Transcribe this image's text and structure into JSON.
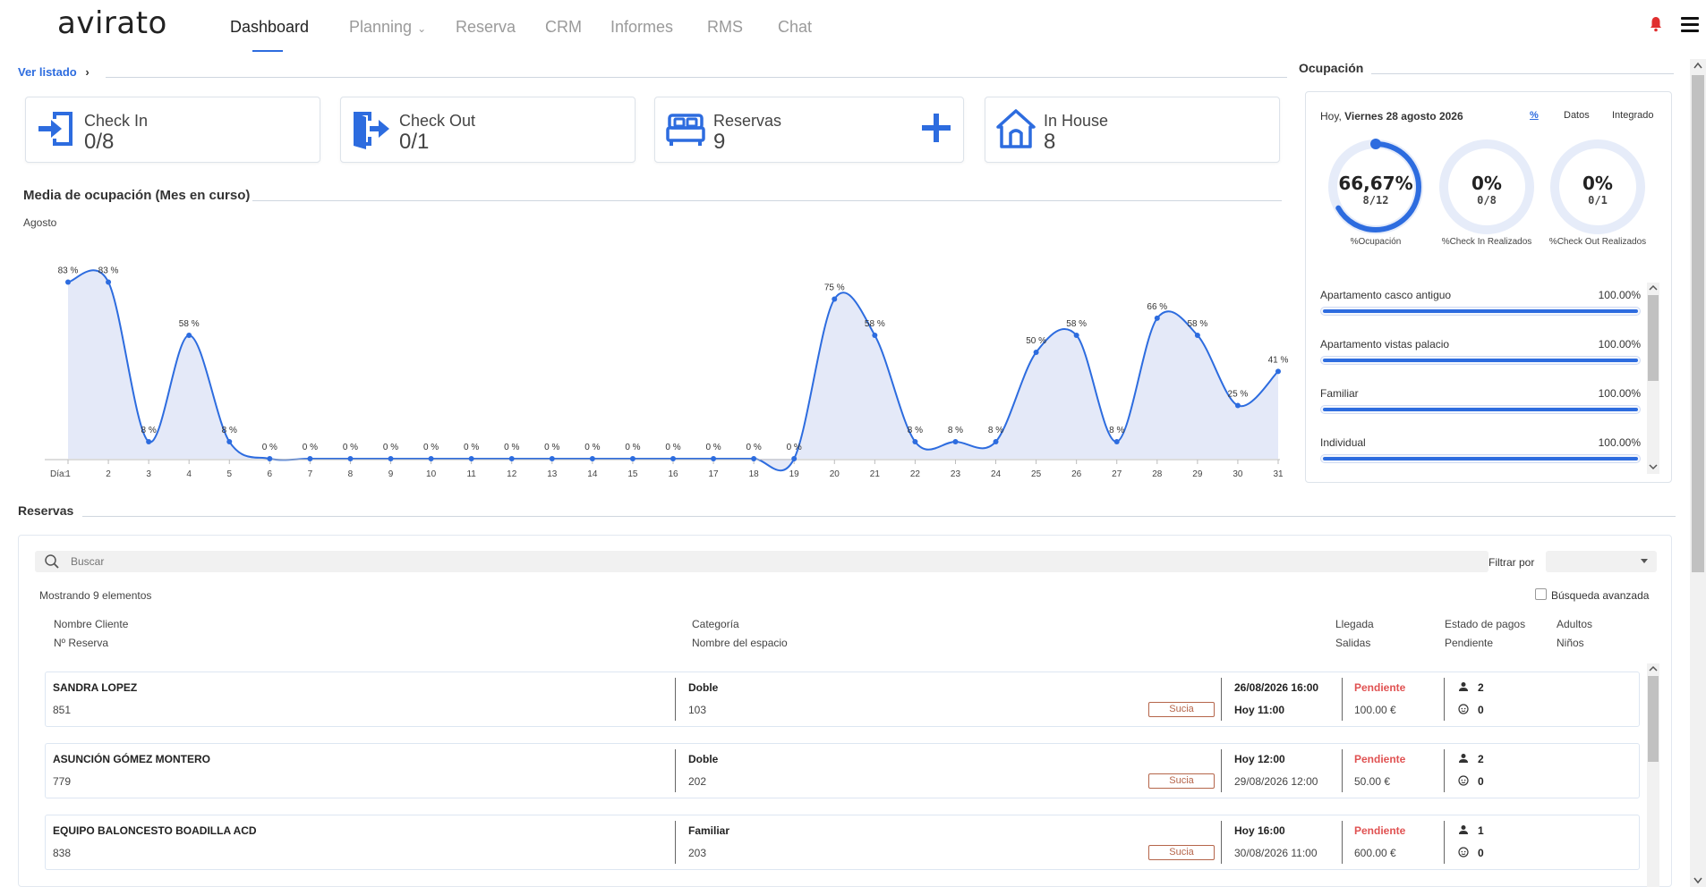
{
  "nav": {
    "logo": "avirato",
    "items": [
      {
        "label": "Dashboard",
        "active": true
      },
      {
        "label": "Planning",
        "has_dropdown": true
      },
      {
        "label": "Reserva"
      },
      {
        "label": "CRM"
      },
      {
        "label": "Informes"
      },
      {
        "label": "RMS"
      },
      {
        "label": "Chat"
      }
    ],
    "icons": [
      "bell-icon",
      "menu-icon"
    ]
  },
  "ver_listado": "Ver listado",
  "cards": [
    {
      "label": "Check In",
      "value": "0/8",
      "icon": "check-in-icon"
    },
    {
      "label": "Check Out",
      "value": "0/1",
      "icon": "check-out-icon"
    },
    {
      "label": "Reservas",
      "value": "9",
      "icon": "bed-icon",
      "action_icon": "plus-icon"
    },
    {
      "label": "In House",
      "value": "8",
      "icon": "house-icon"
    }
  ],
  "chart_section_title": "Media de ocupación (Mes en curso)",
  "chart_data": {
    "type": "area",
    "subtitle": "Agosto",
    "xlabel": "Día:",
    "x": [
      1,
      2,
      3,
      4,
      5,
      6,
      7,
      8,
      9,
      10,
      11,
      12,
      13,
      14,
      15,
      16,
      17,
      18,
      19,
      20,
      21,
      22,
      23,
      24,
      25,
      26,
      27,
      28,
      29,
      30,
      31
    ],
    "values": [
      83,
      83,
      8,
      58,
      8,
      0,
      0,
      0,
      0,
      0,
      0,
      0,
      0,
      0,
      0,
      0,
      0,
      0,
      0,
      75,
      58,
      8,
      8,
      8,
      50,
      58,
      8,
      66,
      58,
      25,
      41
    ],
    "value_suffix": " %",
    "ylim": [
      0,
      100
    ],
    "color": "#2d6cdf",
    "fill_color": "#e4e9f8",
    "grid": false
  },
  "occupancy": {
    "title": "Ocupación",
    "date_prefix": "Hoy, ",
    "date": "Viernes 28 agosto 2026",
    "tabs": [
      {
        "label": "%",
        "active": true
      },
      {
        "label": "Datos"
      },
      {
        "label": "Integrado"
      }
    ],
    "donuts": [
      {
        "value": "66,67%",
        "sub": "8/12",
        "label": "%Ocupación",
        "fraction": 0.6667
      },
      {
        "value": "0%",
        "sub": "0/8",
        "label": "%Check In Realizados",
        "fraction": 0
      },
      {
        "value": "0%",
        "sub": "0/1",
        "label": "%Check Out Realizados",
        "fraction": 0
      }
    ],
    "rooms": [
      {
        "name": "Apartamento casco antiguo",
        "pct": "100.00%",
        "fraction": 1.0
      },
      {
        "name": "Apartamento vistas palacio",
        "pct": "100.00%",
        "fraction": 1.0
      },
      {
        "name": "Familiar",
        "pct": "100.00%",
        "fraction": 1.0
      },
      {
        "name": "Individual",
        "pct": "100.00%",
        "fraction": 1.0
      }
    ]
  },
  "reservas": {
    "title": "Reservas",
    "search_placeholder": "Buscar",
    "filter_label": "Filtrar por",
    "filter_value": "",
    "showing": "Mostrando 9 elementos",
    "advanced_search": "Búsqueda avanzada",
    "columns": {
      "name": "Nombre Cliente",
      "number": "Nº Reserva",
      "category": "Categoría",
      "space": "Nombre del espacio",
      "arrival": "Llegada",
      "departure": "Salidas",
      "payment_status": "Estado de pagos",
      "pending": "Pendiente",
      "adults": "Adultos",
      "children": "Niños"
    },
    "rows": [
      {
        "name": "SANDRA LOPEZ",
        "number": "851",
        "category": "Doble",
        "room": "103",
        "status": "Sucia",
        "arrival": "26/08/2026 16:00",
        "arrival_bold": true,
        "departure": "Hoy 11:00",
        "departure_bold": true,
        "payment": "Pendiente",
        "amount": "100.00 €",
        "adults": "2",
        "children": "0"
      },
      {
        "name": "ASUNCIÓN GÓMEZ MONTERO",
        "number": "779",
        "category": "Doble",
        "room": "202",
        "status": "Sucia",
        "arrival": "Hoy 12:00",
        "arrival_bold": true,
        "departure": "29/08/2026 12:00",
        "departure_bold": false,
        "payment": "Pendiente",
        "amount": "50.00 €",
        "adults": "2",
        "children": "0"
      },
      {
        "name": "EQUIPO BALONCESTO BOADILLA ACD",
        "number": "838",
        "category": "Familiar",
        "room": "203",
        "status": "Sucia",
        "arrival": "Hoy 16:00",
        "arrival_bold": true,
        "departure": "30/08/2026 11:00",
        "departure_bold": false,
        "payment": "Pendiente",
        "amount": "600.00 €",
        "adults": "1",
        "children": "0"
      }
    ]
  }
}
